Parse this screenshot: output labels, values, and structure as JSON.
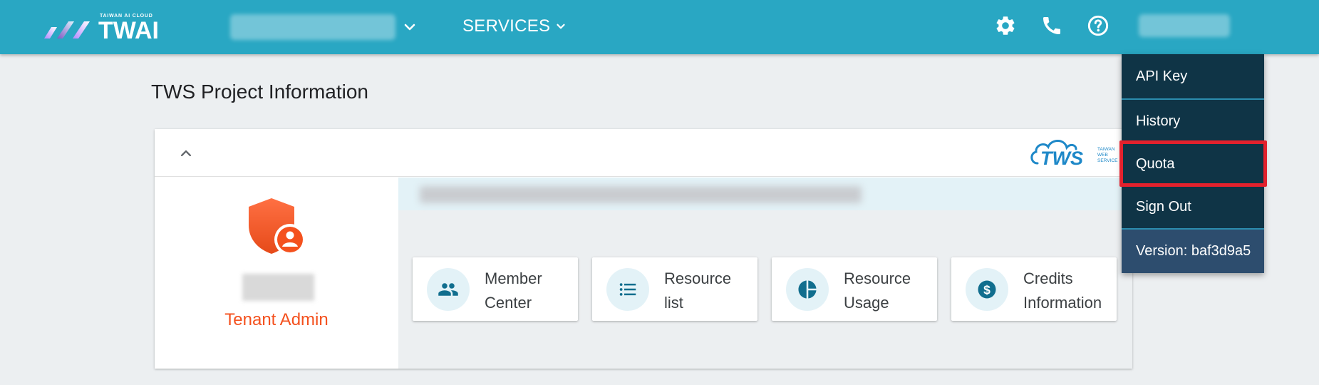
{
  "header": {
    "logo_tagline": "TAIWAN AI CLOUD",
    "logo_text": "TWAI",
    "services_label": "SERVICES",
    "icons": [
      "gear-icon",
      "phone-icon",
      "help-icon"
    ],
    "brand_color": "#29a7c3"
  },
  "page": {
    "title": "TWS Project Information",
    "tws_logo_text": "TWS",
    "tws_logo_sub": [
      "TAIWAN",
      "WEB",
      "SERVICE"
    ]
  },
  "profile": {
    "role": "Tenant Admin",
    "role_color": "#f4511e"
  },
  "tiles": [
    {
      "label_line1": "Member",
      "label_line2": "Center",
      "icon": "people-icon"
    },
    {
      "label_line1": "Resource",
      "label_line2": "list",
      "icon": "list-icon"
    },
    {
      "label_line1": "Resource",
      "label_line2": "Usage",
      "icon": "pie-chart-icon"
    },
    {
      "label_line1": "Credits",
      "label_line2": "Information",
      "icon": "dollar-icon"
    }
  ],
  "user_menu": {
    "items": [
      "API Key",
      "History",
      "Quota",
      "Sign Out"
    ],
    "version": "Version: baf3d9a5",
    "highlighted": "Quota",
    "highlight_color": "#e3212d"
  }
}
